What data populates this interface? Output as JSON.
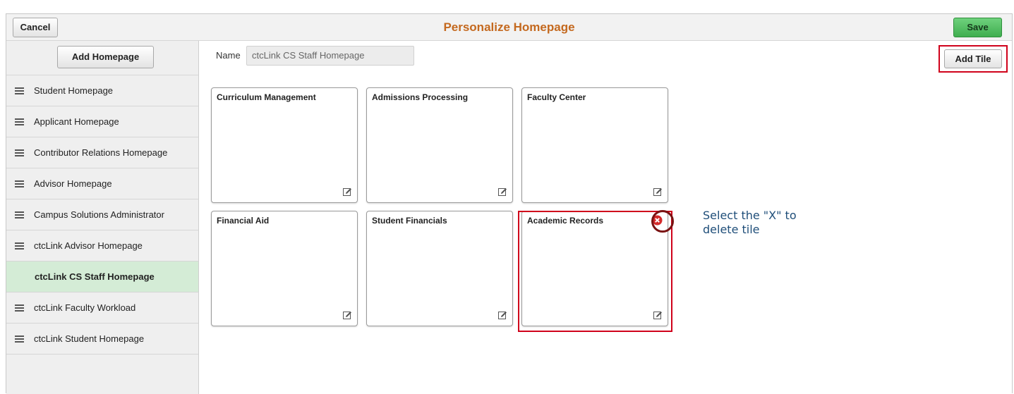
{
  "header": {
    "cancel_label": "Cancel",
    "title": "Personalize Homepage",
    "save_label": "Save"
  },
  "sidebar": {
    "add_homepage_label": "Add Homepage",
    "items": [
      {
        "label": "Student Homepage",
        "active": false
      },
      {
        "label": "Applicant Homepage",
        "active": false
      },
      {
        "label": "Contributor Relations Homepage",
        "active": false
      },
      {
        "label": "Advisor Homepage",
        "active": false
      },
      {
        "label": "Campus Solutions Administrator",
        "active": false
      },
      {
        "label": "ctcLink Advisor Homepage",
        "active": false
      },
      {
        "label": "ctcLink CS Staff Homepage",
        "active": true
      },
      {
        "label": "ctcLink Faculty Workload",
        "active": false
      },
      {
        "label": "ctcLink Student Homepage",
        "active": false
      }
    ]
  },
  "main": {
    "name_label": "Name",
    "name_value": "ctcLink CS Staff Homepage",
    "add_tile_label": "Add Tile",
    "tiles": [
      {
        "title": "Curriculum Management"
      },
      {
        "title": "Admissions Processing"
      },
      {
        "title": "Faculty Center"
      },
      {
        "title": "Financial Aid"
      },
      {
        "title": "Student Financials"
      },
      {
        "title": "Academic Records",
        "deletable": true
      }
    ]
  },
  "annotation": {
    "callout_line1": "Select the \"X\" to",
    "callout_line2": "delete tile"
  },
  "colors": {
    "title": "#c4691f",
    "save": "#4cba5c",
    "active_item": "#d4ecd6",
    "highlight": "#d0021b",
    "callout_text": "#1f4e79"
  }
}
